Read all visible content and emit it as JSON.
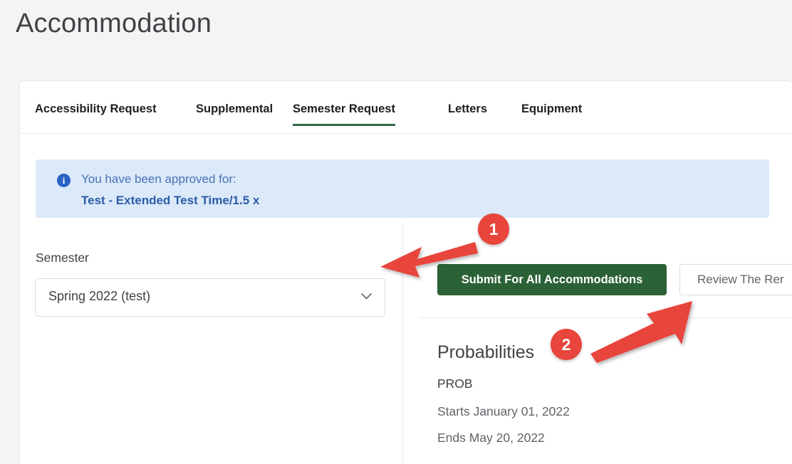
{
  "page": {
    "title": "Accommodation",
    "background_color": "#f4f4f4"
  },
  "tabs": [
    {
      "label": "Accessibility Request",
      "active": false
    },
    {
      "label": "Supplemental",
      "active": false
    },
    {
      "label": "Semester Request",
      "active": true
    },
    {
      "label": "Letters",
      "active": false
    },
    {
      "label": "Equipment",
      "active": false
    }
  ],
  "alert": {
    "icon": "info-icon",
    "icon_glyph": "i",
    "line1": "You have been approved for:",
    "line2": "Test - Extended Test Time/1.5 x",
    "background_color": "#dbe9f9",
    "text_color": "#4a72b8"
  },
  "semester": {
    "label": "Semester",
    "selected": "Spring 2022 (test)",
    "caret_icon": "chevron-down-icon"
  },
  "actions": {
    "primary_label": "Submit For All Accommodations",
    "primary_color": "#2a6136",
    "secondary_label": "Review The Rer"
  },
  "probabilities": {
    "heading": "Probabilities",
    "code": "PROB",
    "starts": "Starts January 01, 2022",
    "ends": "Ends May 20, 2022"
  },
  "annotations": {
    "accent_color": "#e8453c",
    "markers": [
      {
        "number": "1"
      },
      {
        "number": "2"
      }
    ]
  }
}
